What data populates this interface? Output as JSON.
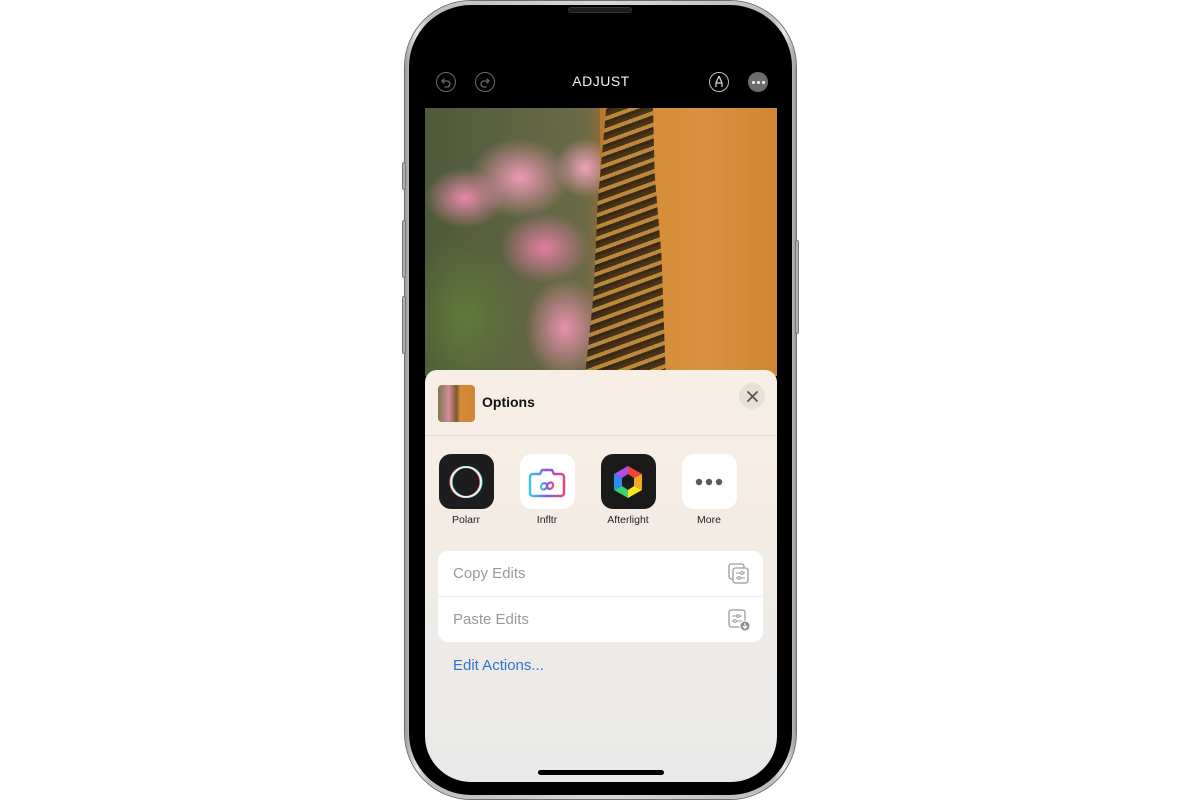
{
  "toolbar": {
    "title": "ADJUST",
    "undo_icon": "undo-icon",
    "redo_icon": "redo-icon",
    "markup_icon": "markup-pen-icon",
    "more_icon": "ellipsis-icon"
  },
  "photo": {
    "description": "Bees clustered on orange hive wall beside pink flowers"
  },
  "sheet": {
    "title": "Options",
    "close_icon": "close-icon",
    "apps": [
      {
        "label": "Polarr",
        "icon": "polarr-app-icon"
      },
      {
        "label": "Infltr",
        "icon": "infltr-app-icon"
      },
      {
        "label": "Afterlight",
        "icon": "afterlight-app-icon"
      },
      {
        "label": "More",
        "icon": "more-dots-icon"
      }
    ],
    "actions": [
      {
        "label": "Copy Edits",
        "icon": "copy-edits-icon"
      },
      {
        "label": "Paste Edits",
        "icon": "paste-edits-icon"
      }
    ],
    "edit_actions_label": "Edit Actions...",
    "link_color": "#2e74c9"
  }
}
